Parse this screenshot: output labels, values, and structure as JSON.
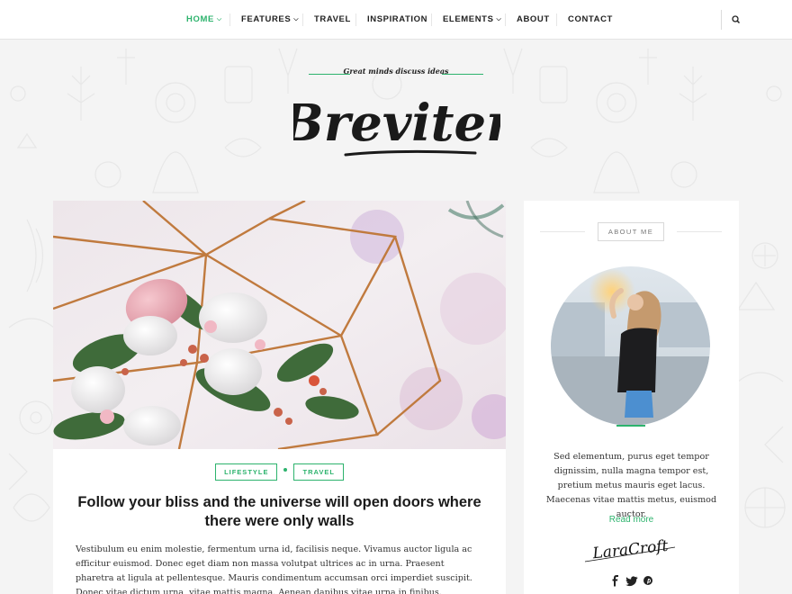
{
  "nav": {
    "items": [
      {
        "label": "HOME",
        "has_dropdown": true,
        "active": true
      },
      {
        "label": "FEATURES",
        "has_dropdown": true,
        "active": false
      },
      {
        "label": "TRAVEL",
        "has_dropdown": false,
        "active": false
      },
      {
        "label": "INSPIRATION",
        "has_dropdown": false,
        "active": false
      },
      {
        "label": "ELEMENTS",
        "has_dropdown": true,
        "active": false
      },
      {
        "label": "ABOUT",
        "has_dropdown": false,
        "active": false
      },
      {
        "label": "CONTACT",
        "has_dropdown": false,
        "active": false
      }
    ],
    "search_icon": "search-icon"
  },
  "header": {
    "tagline": "Great minds discuss ideas",
    "logo_text": "Breviter"
  },
  "post": {
    "categories": [
      "LIFESTYLE",
      "TRAVEL"
    ],
    "title": "Follow your bliss and the universe will open doors where there were only walls",
    "excerpt": "Vestibulum eu enim molestie, fermentum urna id, facilisis neque. Vivamus auctor ligula ac efficitur euismod. Donec eget diam non massa volutpat ultrices ac in urna. Praesent pharetra at ligula at pellentesque. Mauris condimentum accumsan orci imperdiet suscipit. Donec vitae dictum urna, vitae mattis magna. Aenean dapibus vitae urna in finibus."
  },
  "sidebar": {
    "widget_title": "ABOUT ME",
    "about_text": "Sed elementum, purus eget tempor dignissim, nulla magna tempor est, pretium metus mauris eget lacus. Maecenas vitae mattis metus, euismod auctor.",
    "read_more": "Read more",
    "signature_text": "LaraCroft",
    "socials": [
      "facebook-icon",
      "twitter-icon",
      "pinterest-icon"
    ]
  },
  "colors": {
    "accent": "#2db36d",
    "background": "#f4f4f4",
    "text": "#222222"
  }
}
